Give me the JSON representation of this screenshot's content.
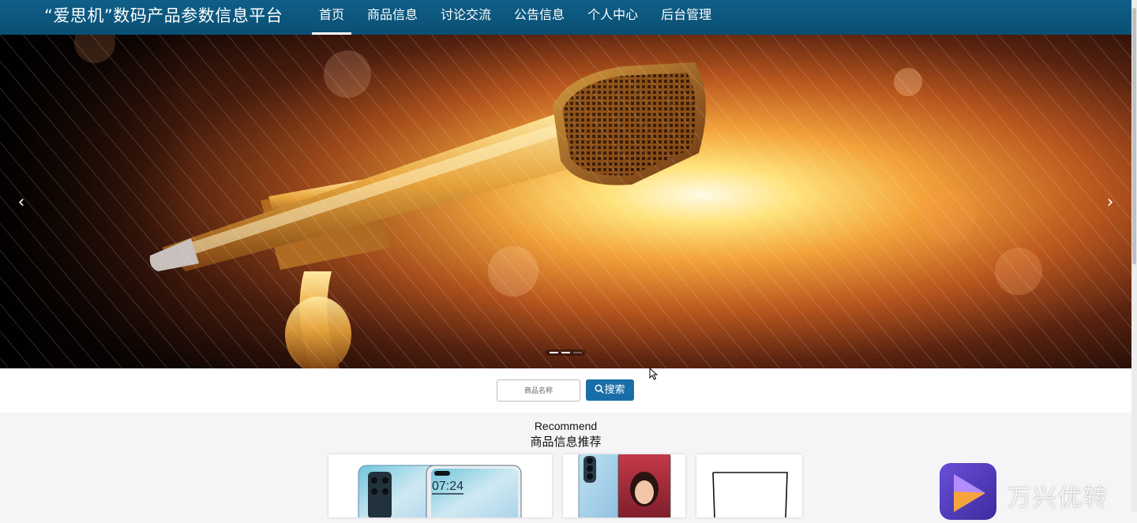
{
  "header": {
    "site_title": "“爱思机”数码产品参数信息平台",
    "nav": [
      {
        "label": "首页",
        "active": true
      },
      {
        "label": "商品信息"
      },
      {
        "label": "讨论交流"
      },
      {
        "label": "公告信息"
      },
      {
        "label": "个人中心"
      },
      {
        "label": "后台管理"
      }
    ]
  },
  "carousel": {
    "prev_icon": "chevron-left-icon",
    "next_icon": "chevron-right-icon",
    "prev_glyph": "‹",
    "next_glyph": "›",
    "slide_count": 3,
    "active_index": 2
  },
  "search": {
    "placeholder": "商品名称",
    "button_label": "搜索",
    "button_icon": "search-icon",
    "button_color": "#1a6ea8"
  },
  "recommend": {
    "title_en": "Recommend",
    "title_cn": "商品信息推荐",
    "product_images": [
      "huawei-phone-image",
      "oppo-phone-image",
      "product-outline-image"
    ],
    "phone_time": "07:24"
  },
  "watermark": {
    "text": "万兴优转",
    "logo_icon": "play-logo-icon"
  },
  "colors": {
    "nav_bg": "#0a5a80",
    "accent": "#1a6ea8"
  }
}
